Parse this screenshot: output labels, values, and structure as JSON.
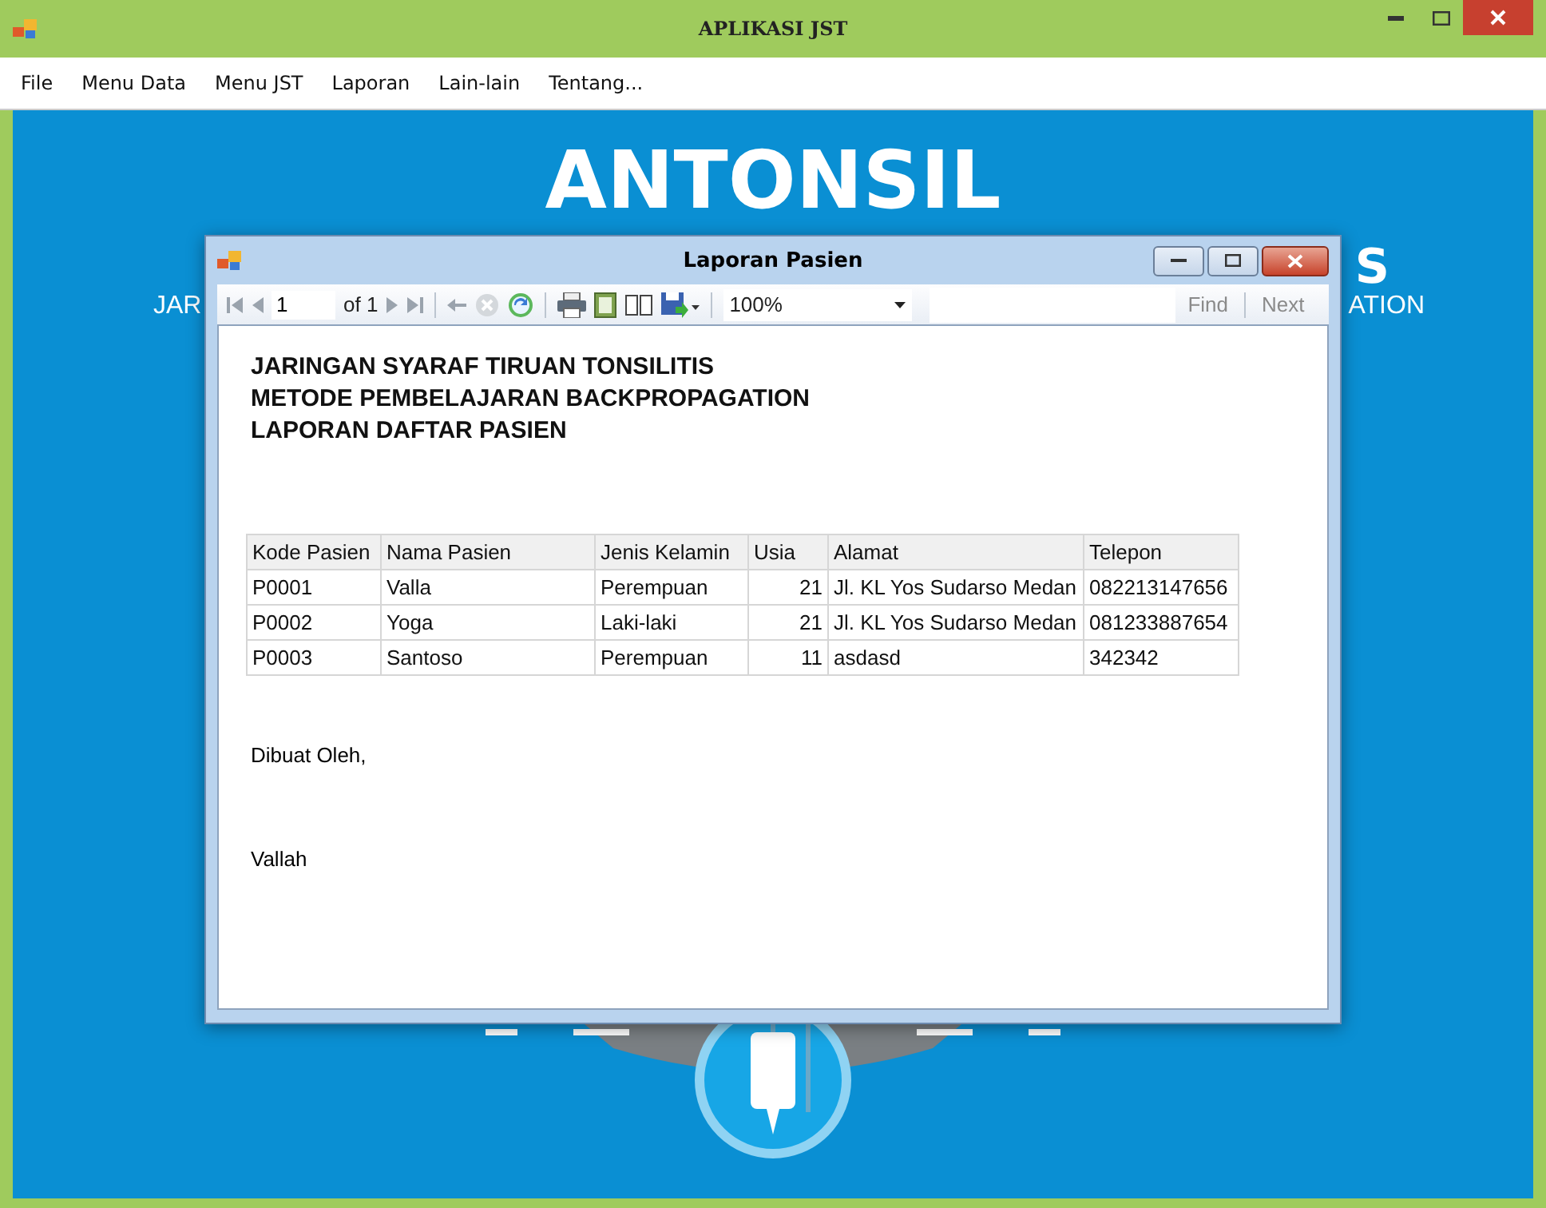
{
  "window": {
    "title": "APLIKASI JST"
  },
  "menu": [
    "File",
    "Menu Data",
    "Menu JST",
    "Laporan",
    "Lain-lain",
    "Tentang..."
  ],
  "banner": {
    "title": "ANTONSIL",
    "subtitle_fragment": "S",
    "tagline_left": "JAR",
    "tagline_right": "ATION"
  },
  "dialog": {
    "title": "Laporan Pasien",
    "toolbar": {
      "page": "1",
      "page_count": "of 1",
      "zoom": "100%",
      "find": {
        "label": "Find",
        "disabled": true
      },
      "next": {
        "label": "Next",
        "disabled": true
      }
    },
    "report": {
      "headings": [
        "JARINGAN SYARAF TIRUAN TONSILITIS",
        "METODE PEMBELAJARAN BACKPROPAGATION",
        "LAPORAN DAFTAR PASIEN"
      ],
      "table": {
        "columns": [
          "Kode Pasien",
          "Nama Pasien",
          "Jenis Kelamin",
          "Usia",
          "Alamat",
          "Telepon"
        ],
        "rows": [
          [
            "P0001",
            "Valla",
            "Perempuan",
            "21",
            "Jl. KL Yos Sudarso Medan",
            "082213147656"
          ],
          [
            "P0002",
            "Yoga",
            "Laki-laki",
            "21",
            "Jl. KL Yos Sudarso Medan",
            "081233887654"
          ],
          [
            "P0003",
            "Santoso",
            "Perempuan",
            "11",
            "asdasd",
            "342342"
          ]
        ]
      },
      "footer_label": "Dibuat Oleh,",
      "signer": "Vallah"
    }
  }
}
